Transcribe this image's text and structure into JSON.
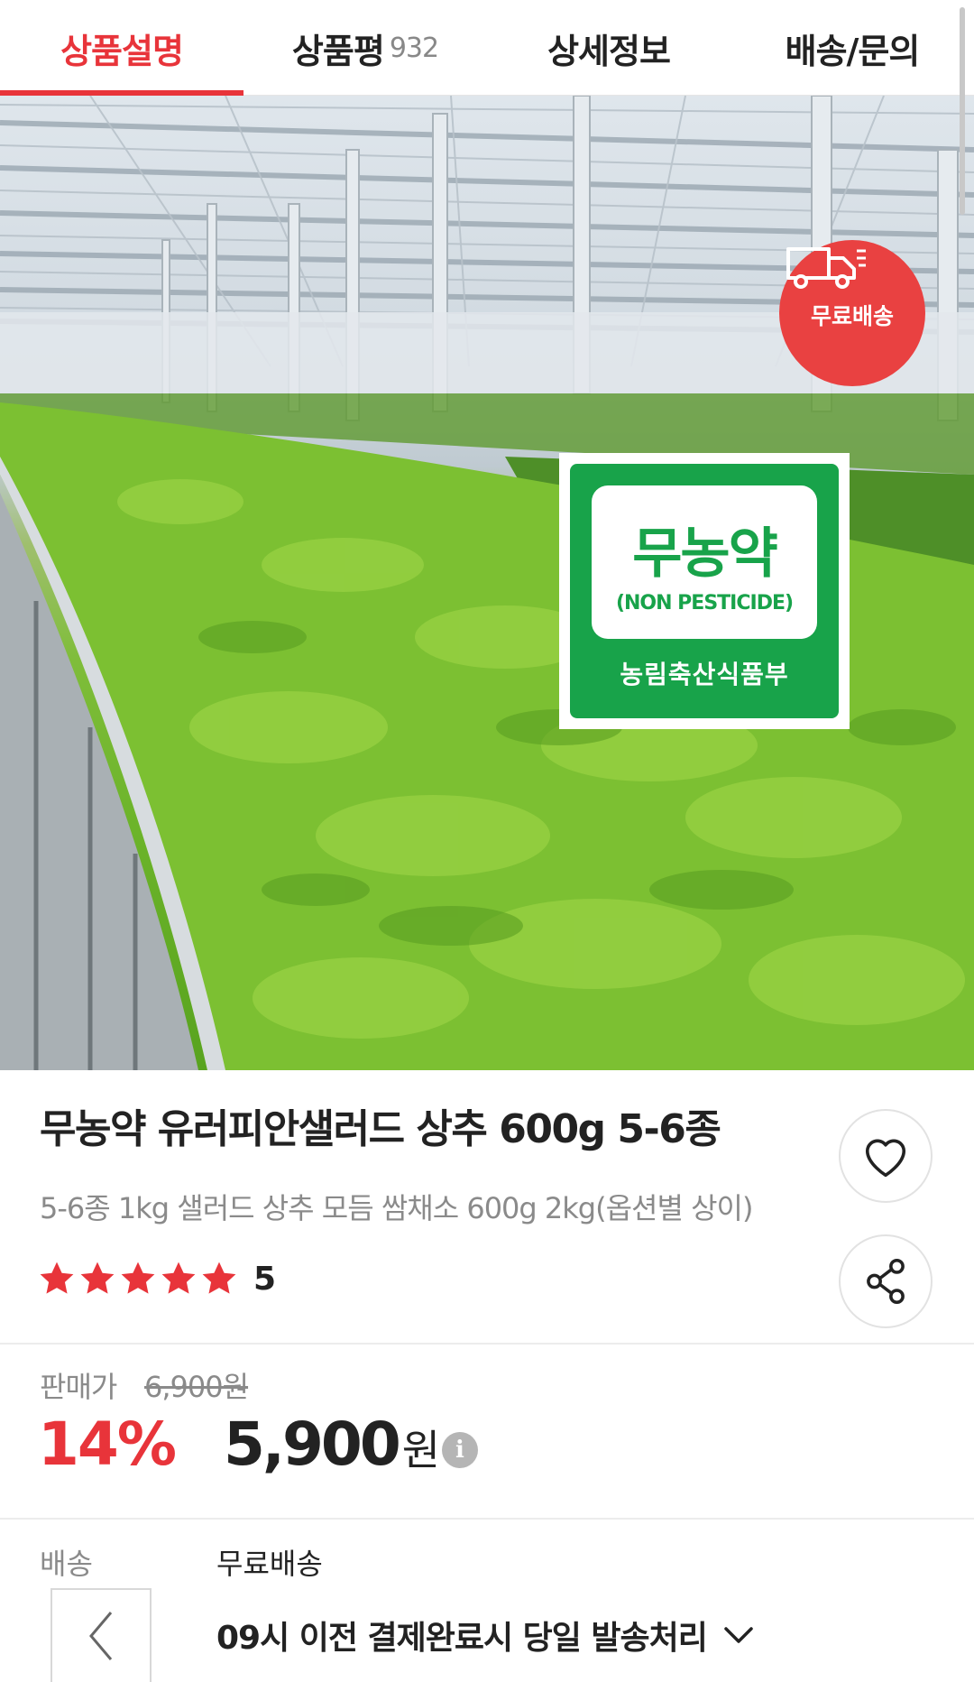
{
  "tabs": [
    {
      "label": "상품설명",
      "active": true
    },
    {
      "label": "상품평",
      "count": "932",
      "active": false
    },
    {
      "label": "상세정보",
      "active": false
    },
    {
      "label": "배송/문의",
      "active": false
    }
  ],
  "hero": {
    "free_shipping_badge": "무료배송",
    "badge_icon": "truck-icon",
    "certification": {
      "title": "무농약",
      "subtitle": "(NON PESTICIDE)",
      "issuer": "농림축산식품부"
    }
  },
  "product": {
    "title": "무농약 유러피안샐러드 상추 600g 5-6종",
    "subtitle": "5-6종 1kg 샐러드 상추 모듬 쌈채소 600g 2kg(옵션별 상이)",
    "rating": 5,
    "rating_label": "5"
  },
  "price": {
    "label": "판매가",
    "original": "6,900원",
    "discount": "14%",
    "sale": "5,900",
    "unit": "원",
    "info_icon": "i"
  },
  "shipping": {
    "label": "배송",
    "value": "무료배송",
    "note": "09시 이전 결제완료시 당일 발송처리"
  },
  "colors": {
    "accent": "#e8343a",
    "badge_red": "#e94141",
    "cert_green": "#18a34a"
  }
}
